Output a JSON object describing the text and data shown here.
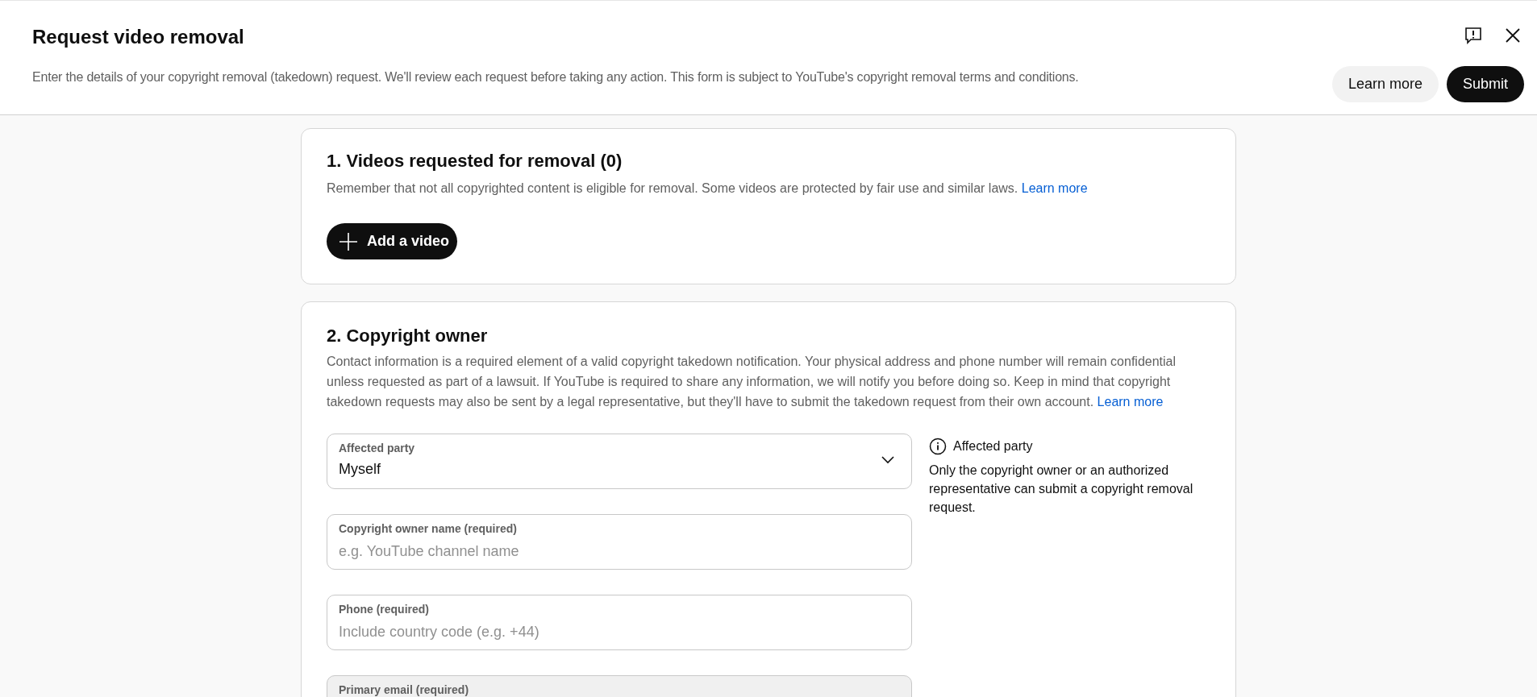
{
  "header": {
    "title": "Request video removal",
    "description": "Enter the details of your copyright removal (takedown) request. We'll review each request before taking any action. This form is subject to YouTube's copyright removal terms and conditions.",
    "buttons": [
      {
        "label": "Learn more",
        "kind": "secondary"
      },
      {
        "label": "Submit",
        "kind": "primary"
      }
    ]
  },
  "sections": [
    {
      "title": "1. Videos requested for removal (0)",
      "text": "Remember that not all copyrighted content is eligible for removal. Some videos are protected by fair use and similar laws.",
      "link": "Learn more",
      "button": "Add a video"
    },
    {
      "title": "2. Copyright owner",
      "text": "Contact information is a required element of a valid copyright takedown notification. Your physical address and phone number will remain confidential unless requested as part of a lawsuit. If YouTube is required to share any information, we will notify you before doing so. Keep in mind that copyright takedown requests may also be sent by a legal representative, but they'll have to submit the takedown request from their own account.",
      "link": "Learn more",
      "fields": [
        {
          "kind": "select",
          "label": "Affected party",
          "value": "Myself",
          "disabled": false
        },
        {
          "kind": "text",
          "label": "Copyright owner name (required)",
          "placeholder": "e.g. YouTube channel name",
          "disabled": false
        },
        {
          "kind": "text",
          "label": "Phone (required)",
          "placeholder": "Include country code (e.g. +44)",
          "disabled": false
        },
        {
          "kind": "text",
          "label": "Primary email (required)",
          "disabled": true
        }
      ],
      "info": {
        "title": "Affected party",
        "text": "Only the copyright owner or an authorized representative can submit a copyright removal request."
      }
    }
  ]
}
